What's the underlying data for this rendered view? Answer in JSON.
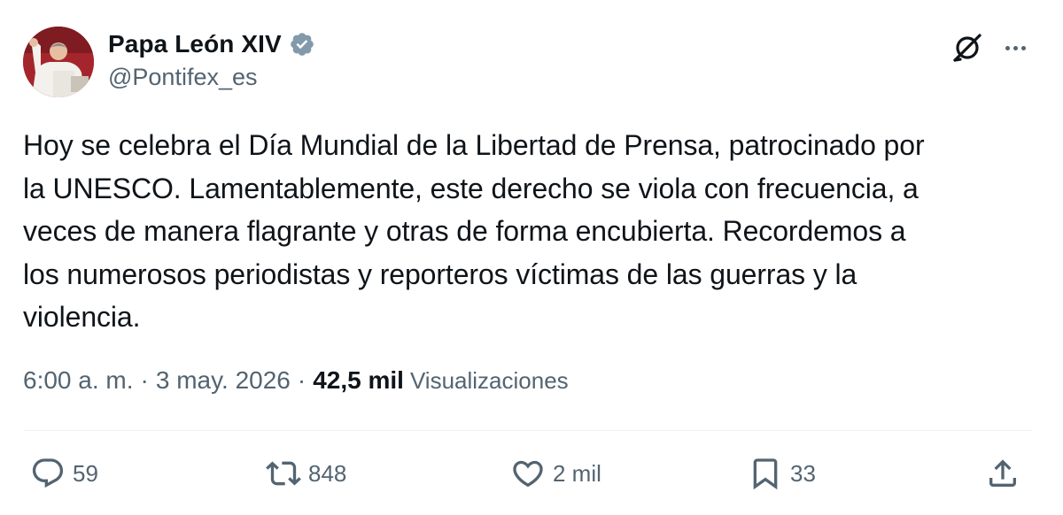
{
  "author": {
    "display_name": "Papa León XIV",
    "handle": "@Pontifex_es",
    "verified": true,
    "verified_color": "#829aab"
  },
  "tweet": {
    "text": "Hoy se celebra el Día Mundial de la Libertad de Prensa, patrocinado por\nla UNESCO. Lamentablemente, este derecho se viola con frecuencia, a\nveces de manera flagrante y otras de forma encubierta. Recordemos a\nlos numerosos periodistas y reporteros víctimas de las guerras y la\nviolencia."
  },
  "meta": {
    "time": "6:00 a. m.",
    "separator": "·",
    "date": "3 may. 2026",
    "views_count": "42,5 mil",
    "views_label": "Visualizaciones"
  },
  "actions": {
    "reply_count": "59",
    "retweet_count": "848",
    "like_count": "2 mil",
    "bookmark_count": "33"
  },
  "icons": {
    "grok": "grok-icon",
    "more": "more-icon",
    "reply": "reply-icon",
    "retweet": "retweet-icon",
    "like": "heart-icon",
    "bookmark": "bookmark-icon",
    "share": "share-icon"
  },
  "colors": {
    "text_primary": "#0f1419",
    "text_secondary": "#536471",
    "divider": "#eff3f4"
  }
}
